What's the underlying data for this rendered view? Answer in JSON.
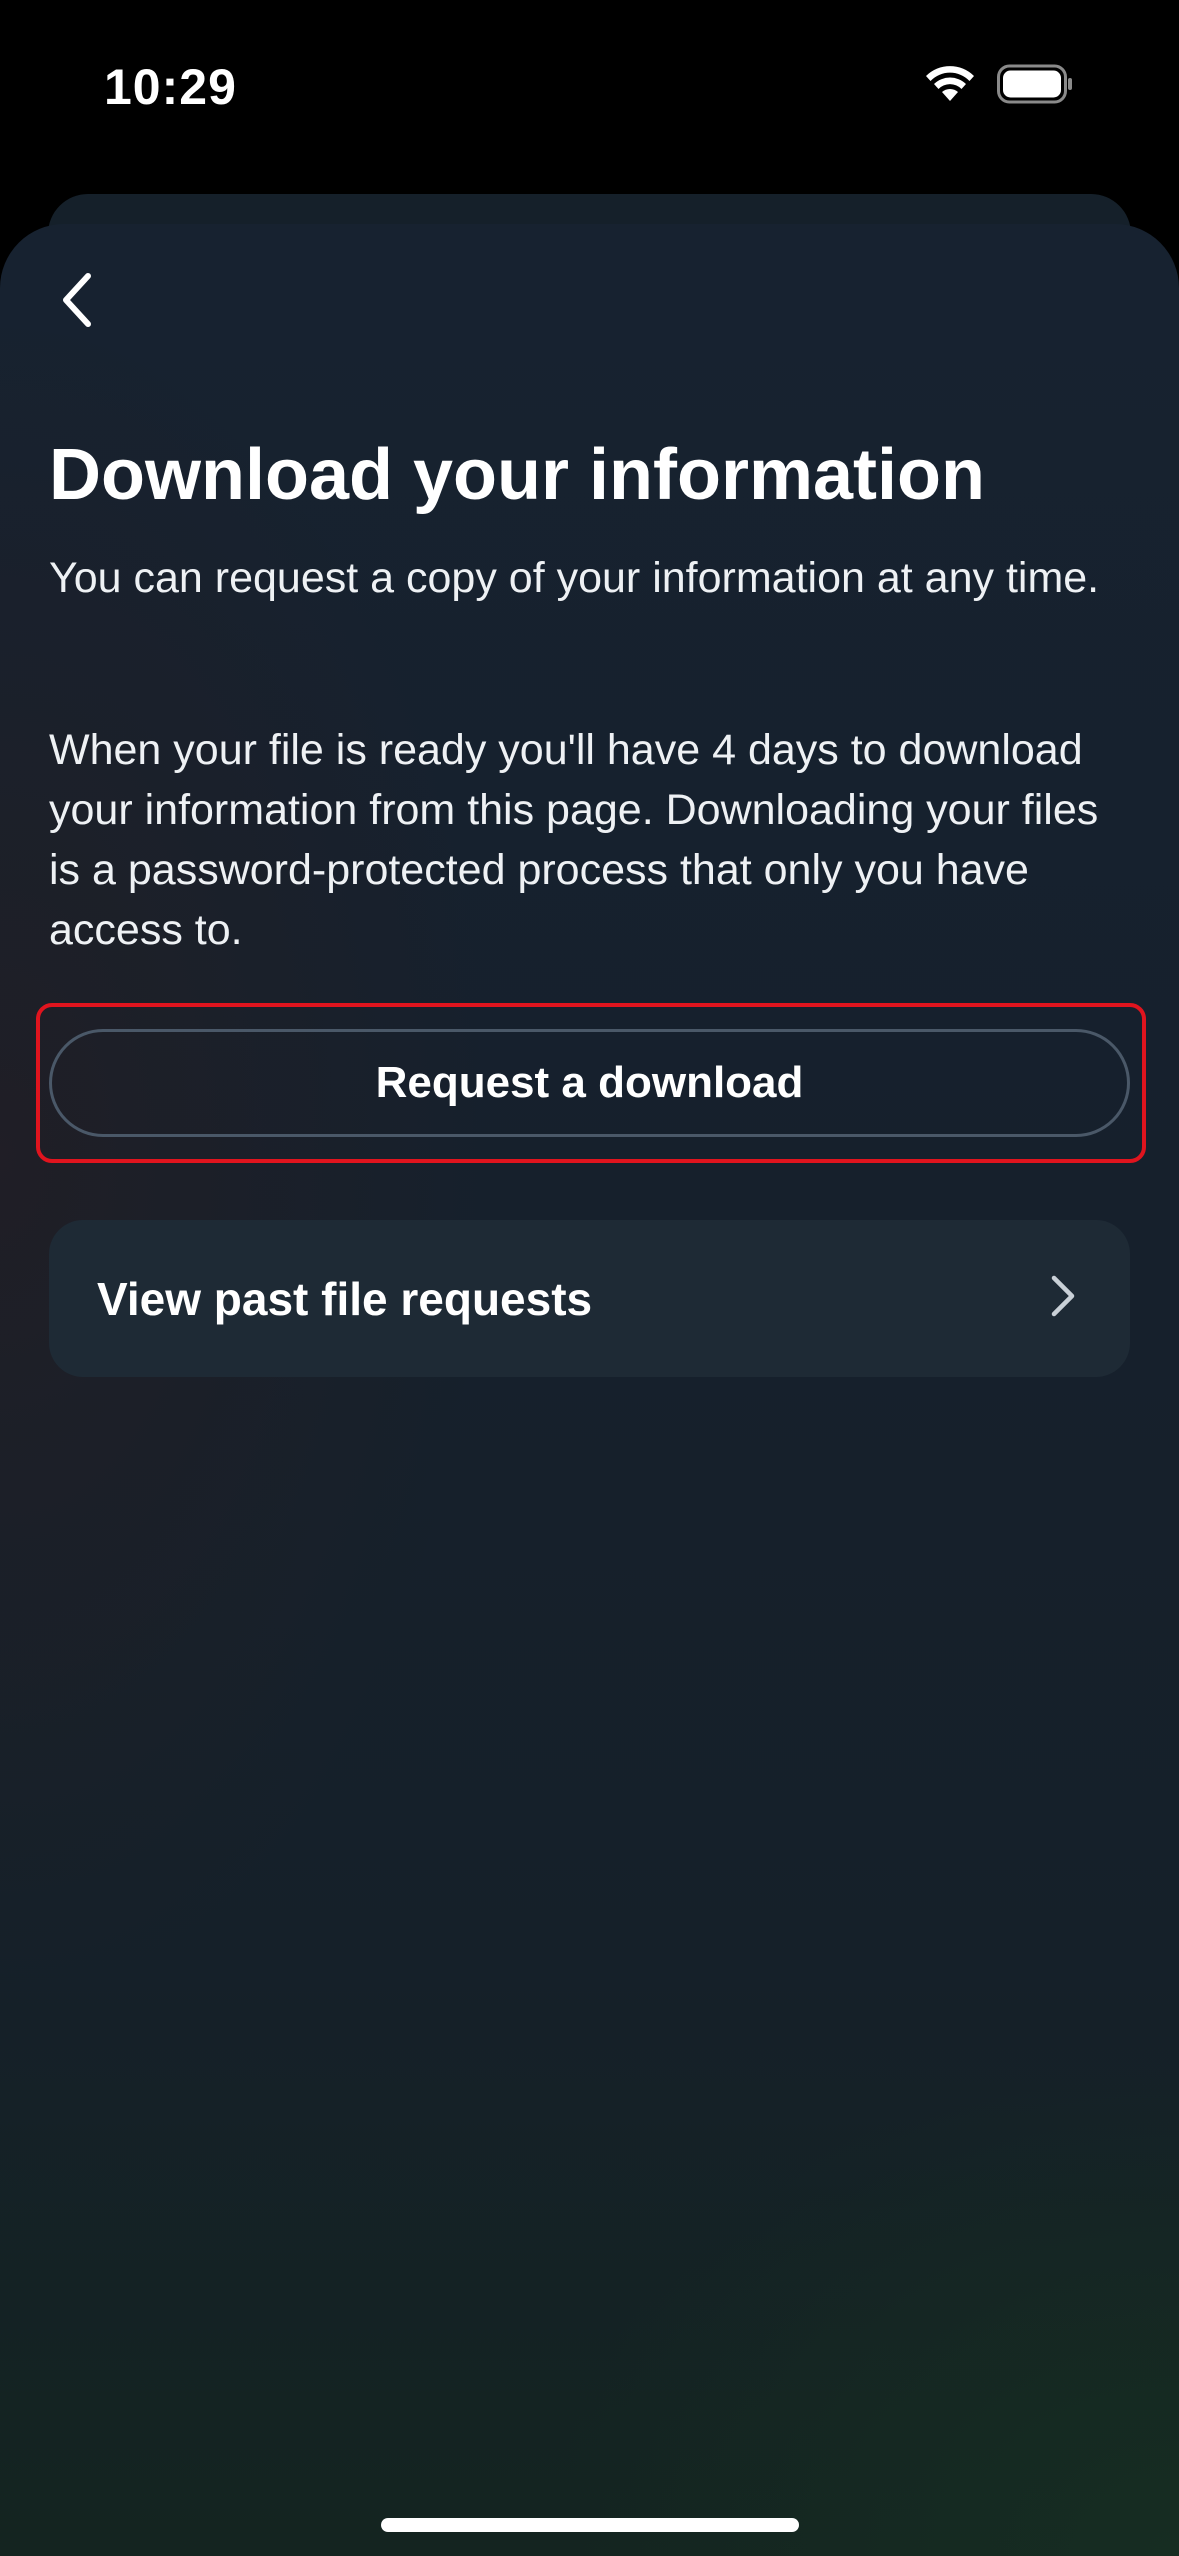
{
  "status_bar": {
    "time": "10:29",
    "icons": [
      "wifi-icon",
      "battery-icon"
    ]
  },
  "header": {
    "back_icon": "chevron-left-icon"
  },
  "main": {
    "title": "Download your information",
    "paragraph_1": "You can request a copy of your information at any time.",
    "paragraph_2": "When your file is ready you'll have 4 days to download your information from this page. Downloading your files is a password-protected process that only you have access to.",
    "request_button_label": "Request a download",
    "past_requests_label": "View past file requests",
    "past_requests_icon": "chevron-right-icon"
  },
  "colors": {
    "highlight": "#e0141e",
    "background": "#172230",
    "card": "#1e2a35",
    "button_border": "#4a5868"
  }
}
